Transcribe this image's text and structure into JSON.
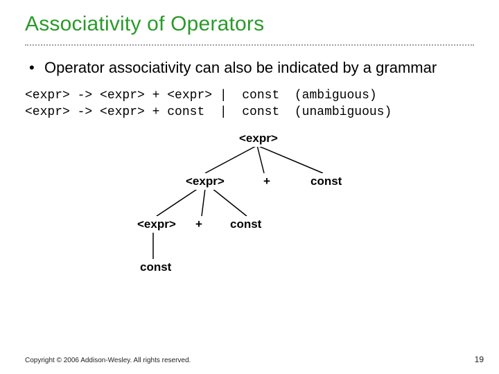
{
  "title": "Associativity of Operators",
  "bullet": "Operator associativity can also be indicated by a grammar",
  "grammar": {
    "line1": "<expr> -> <expr> + <expr> |  const  (ambiguous)",
    "line2": "<expr> -> <expr> + const  |  const  (unambiguous)"
  },
  "tree": {
    "n1": "<expr>",
    "n2": "<expr>",
    "n3": "+",
    "n4": "const",
    "n5": "<expr>",
    "n6": "+",
    "n7": "const",
    "n8": "const"
  },
  "footer": "Copyright © 2006 Addison-Wesley. All rights reserved.",
  "page": "19"
}
